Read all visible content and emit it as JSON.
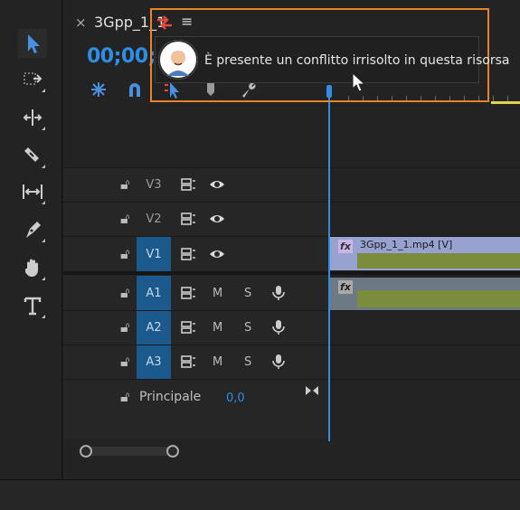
{
  "tab": {
    "close_glyph": "×",
    "title": "3Gpp_1_1",
    "menu_glyph": "≡"
  },
  "timecode": "00;00;0",
  "conflict_tooltip": {
    "text": "È presente un conflitto irrisolto in questa risorsa",
    "avatar_icon": "user-avatar-icon"
  },
  "tools": [
    {
      "name": "selection-tool",
      "selected": true
    },
    {
      "name": "track-select-forward-tool"
    },
    {
      "name": "ripple-edit-tool"
    },
    {
      "name": "razor-tool"
    },
    {
      "name": "slip-tool"
    },
    {
      "name": "pen-tool"
    },
    {
      "name": "hand-tool"
    },
    {
      "name": "type-tool"
    }
  ],
  "toolbar_icons": [
    "nest-sequences-icon",
    "snap-magnet-icon",
    "linked-selection-icon",
    "add-marker-icon",
    "timeline-settings-wrench-icon"
  ],
  "video_tracks": [
    {
      "label": "V3",
      "target": false
    },
    {
      "label": "V2",
      "target": false
    },
    {
      "label": "V1",
      "target": true
    }
  ],
  "audio_tracks": [
    {
      "label": "A1",
      "m": "M",
      "s": "S"
    },
    {
      "label": "A2",
      "m": "M",
      "s": "S"
    },
    {
      "label": "A3",
      "m": "M",
      "s": "S"
    }
  ],
  "clips": {
    "video_title": "3Gpp_1_1.mp4 [V]",
    "fx_label": "fx"
  },
  "master": {
    "label": "Principale",
    "value": "0,0"
  },
  "colors": {
    "accent": "#2f8de4",
    "highlight_border": "#e8832a",
    "track_target": "#1c5a8e",
    "video_clip": "#98a2d0",
    "clip_audio_bar": "#7b8c3d"
  }
}
